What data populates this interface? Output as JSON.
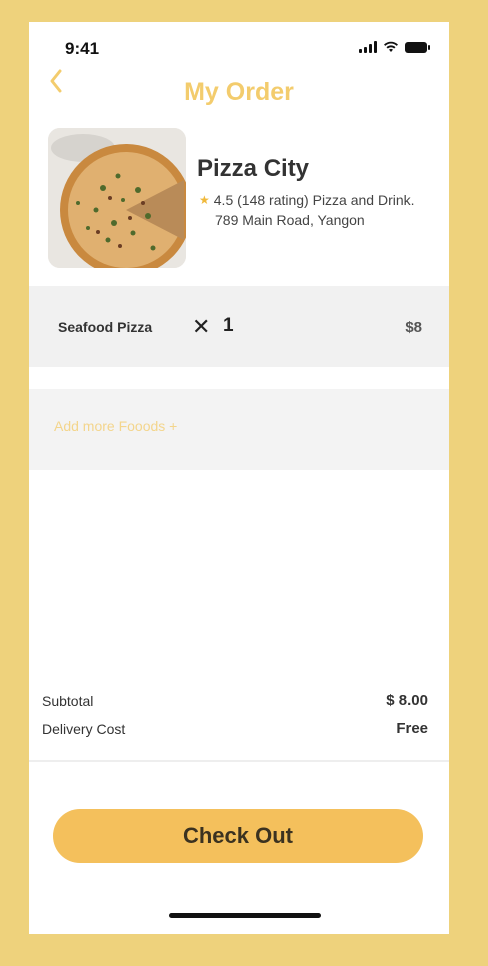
{
  "status_bar": {
    "time": "9:41"
  },
  "header": {
    "title": "My Order"
  },
  "restaurant": {
    "name": "Pizza City",
    "rating_text": "4.5 (148 rating) Pizza and Drink.",
    "address": "789 Main Road, Yangon"
  },
  "order_items": [
    {
      "name": "Seafood Pizza",
      "quantity": "1",
      "price": "$8"
    }
  ],
  "add_more_label": "Add more Fooods +",
  "summary": {
    "subtotal_label": "Subtotal",
    "subtotal_value": "$ 8.00",
    "delivery_label": "Delivery Cost",
    "delivery_value": "Free"
  },
  "checkout_label": "Check Out",
  "colors": {
    "background": "#eed27c",
    "accent": "#f3cc6d",
    "button": "#f4c05c",
    "row_bg": "#f1f1f1"
  }
}
